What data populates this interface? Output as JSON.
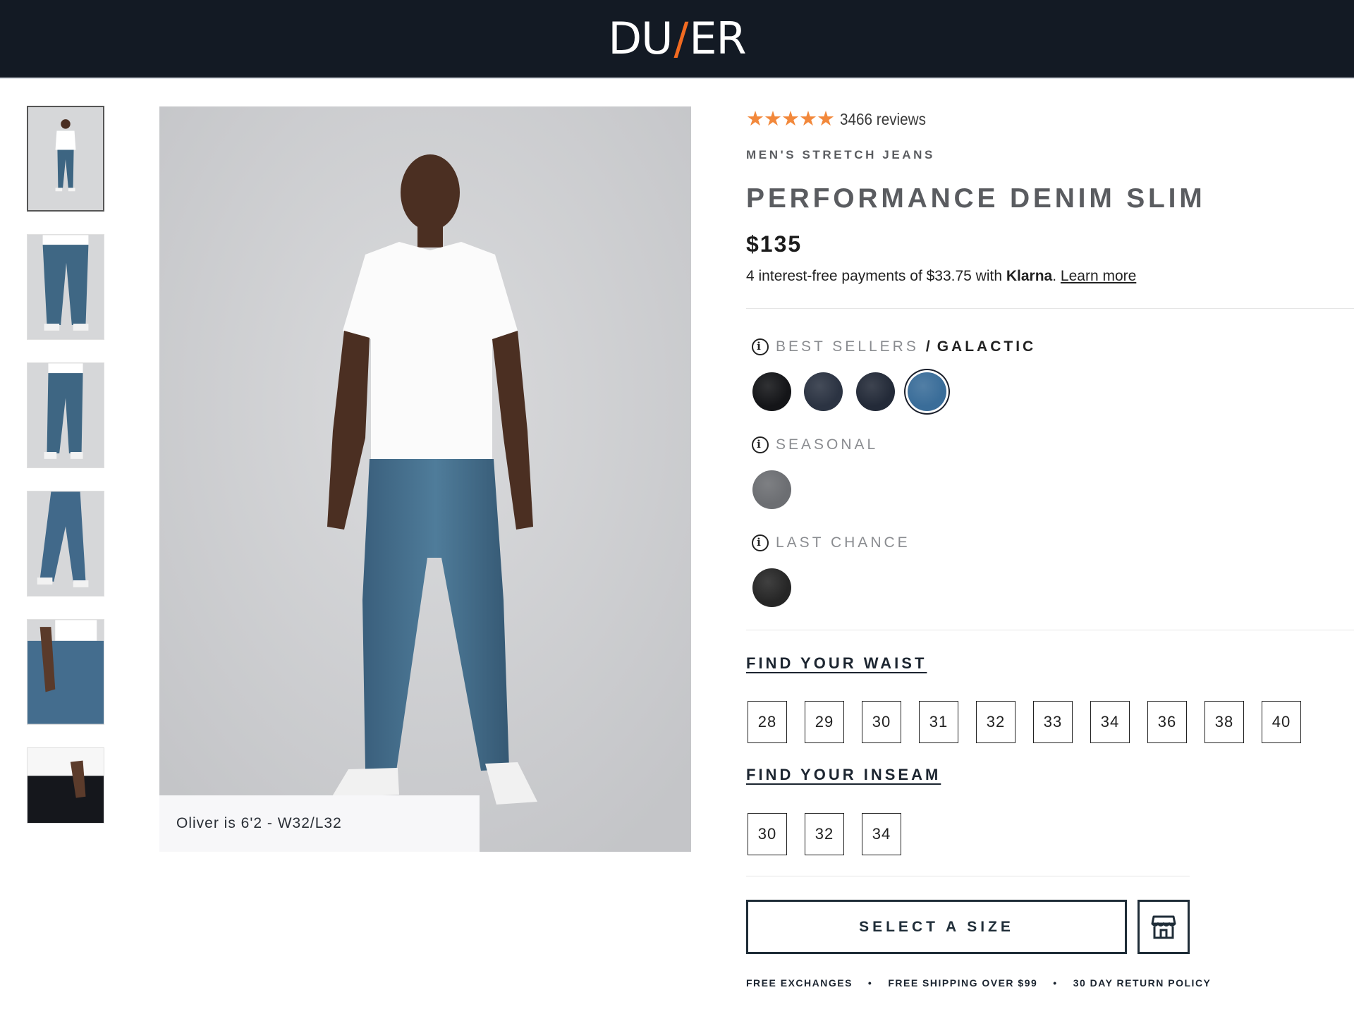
{
  "header": {
    "logo_left": "DU",
    "logo_slash": "/",
    "logo_right": "ER",
    "bg_color": "#131a24",
    "accent_color": "#f26b21"
  },
  "gallery": {
    "thumbnails": [
      {
        "name": "thumb-front-full"
      },
      {
        "name": "thumb-jeans-front"
      },
      {
        "name": "thumb-jeans-side"
      },
      {
        "name": "thumb-jeans-walking"
      },
      {
        "name": "thumb-jeans-closeup"
      },
      {
        "name": "thumb-dark-jeans"
      }
    ],
    "caption": "Oliver is 6'2 - W32/L32"
  },
  "product": {
    "stars": "★★★★★",
    "reviews": "3466 reviews",
    "category": "MEN'S STRETCH JEANS",
    "title": "PERFORMANCE DENIM SLIM",
    "price": "$135",
    "klarna_text": "4 interest-free payments of $33.75 with",
    "klarna_brand": "Klarna",
    "klarna_period": ".",
    "klarna_link": "Learn more",
    "star_color": "#f2883b"
  },
  "colors": {
    "best_sellers_label": "BEST SELLERS",
    "separator": "/",
    "selected_color": "GALACTIC",
    "best_sellers": [
      {
        "name": "black",
        "hex": "#141518"
      },
      {
        "name": "dark-navy",
        "hex": "#2b3342"
      },
      {
        "name": "indigo",
        "hex": "#232a38"
      },
      {
        "name": "galactic",
        "hex": "#3a6d99",
        "selected": true
      }
    ],
    "seasonal_label": "SEASONAL",
    "seasonal": [
      {
        "name": "grey",
        "hex": "#6c6e72"
      }
    ],
    "last_chance_label": "LAST CHANCE",
    "last_chance": [
      {
        "name": "charcoal",
        "hex": "#262626"
      }
    ]
  },
  "sizes": {
    "waist_label": "FIND YOUR WAIST",
    "waist": [
      "28",
      "29",
      "30",
      "31",
      "32",
      "33",
      "34",
      "36",
      "38",
      "40"
    ],
    "inseam_label": "FIND YOUR INSEAM",
    "inseam": [
      "30",
      "32",
      "34"
    ]
  },
  "cta": {
    "select_label": "SELECT A SIZE",
    "store_icon": "store-icon"
  },
  "perks": {
    "items": [
      "FREE EXCHANGES",
      "FREE SHIPPING OVER $99",
      "30 DAY RETURN POLICY"
    ],
    "bullet": "•"
  }
}
